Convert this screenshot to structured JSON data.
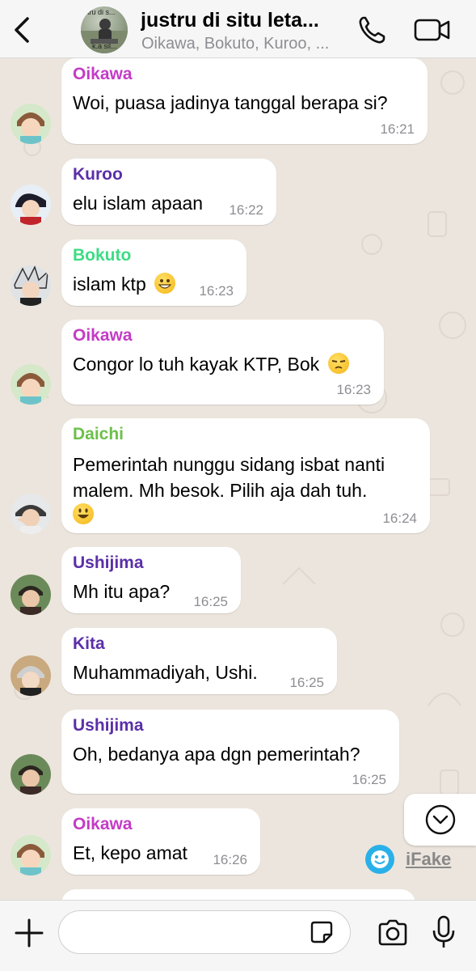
{
  "header": {
    "title": "justru di situ leta...",
    "subtitle": "Oikawa, Bokuto, Kuroo, ...",
    "avatar_text_top": "tru di s...",
    "avatar_text_bottom": "k.a sil..."
  },
  "messages": [
    {
      "sender": "Oikawa",
      "sender_color": "#c43bc6",
      "text": "Woi, puasa jadinya tanggal berapa si?",
      "time": "16:21"
    },
    {
      "sender": "Kuroo",
      "sender_color": "#5a2fa8",
      "text": "elu islam apaan",
      "time": "16:22"
    },
    {
      "sender": "Bokuto",
      "sender_color": "#3ddc84",
      "text": "islam ktp",
      "emoji": "grinning",
      "time": "16:23"
    },
    {
      "sender": "Oikawa",
      "sender_color": "#c43bc6",
      "text": "Congor lo tuh kayak KTP, Bok",
      "emoji": "unamused",
      "time": "16:23"
    },
    {
      "sender": "Daichi",
      "sender_color": "#6cc04a",
      "text_line1": "Pemerintah nunggu sidang isbat nanti",
      "text_line2": "malem. Mh besok. Pilih aja dah tuh.",
      "emoji": "smiley",
      "time": "16:24"
    },
    {
      "sender": "Ushijima",
      "sender_color": "#5a2fa8",
      "text": "Mh itu apa?",
      "time": "16:25"
    },
    {
      "sender": "Kita",
      "sender_color": "#5a2fa8",
      "text": "Muhammadiyah, Ushi.",
      "time": "16:25"
    },
    {
      "sender": "Ushijima",
      "sender_color": "#5a2fa8",
      "text": "Oh, bedanya apa dgn pemerintah?",
      "time": "16:25"
    },
    {
      "sender": "Oikawa",
      "sender_color": "#c43bc6",
      "text": "Et, kepo amat",
      "time": "16:26"
    }
  ],
  "watermark": "iFake",
  "input": {
    "placeholder": ""
  },
  "icons": {
    "back": "chevron-left-icon",
    "call": "phone-icon",
    "video": "video-camera-icon",
    "plus": "plus-icon",
    "sticker": "sticker-icon",
    "camera": "camera-icon",
    "mic": "microphone-icon",
    "scroll": "chevron-down-circle-icon"
  }
}
